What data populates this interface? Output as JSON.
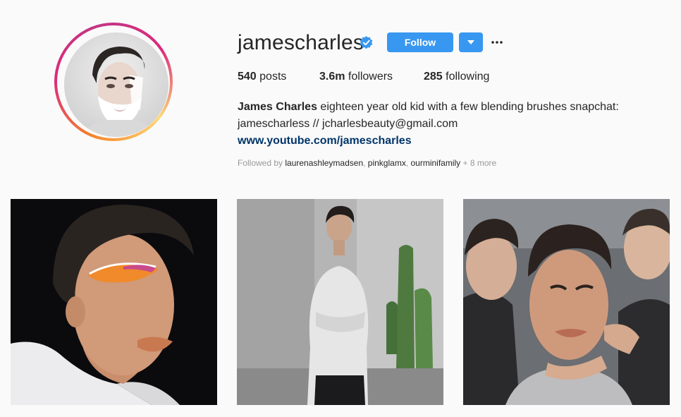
{
  "profile": {
    "username": "jamescharles",
    "verified_icon": "verified-badge-icon",
    "follow_label": "Follow",
    "more_label": "•••",
    "stats": {
      "posts_count": "540",
      "posts_label": "posts",
      "followers_count": "3.6m",
      "followers_label": "followers",
      "following_count": "285",
      "following_label": "following"
    },
    "bio": {
      "name": "James Charles",
      "text": " eighteen year old kid with a few blending brushes snapchat: jamescharless // jcharlesbeauty@gmail.com",
      "link": "www.youtube.com/jamescharles"
    },
    "followed_by": {
      "prefix": "Followed by ",
      "users": [
        "laurenashleymadsen",
        "pinkglamx",
        "ourminifamily"
      ],
      "suffix": " + 8 more"
    }
  },
  "colors": {
    "accent": "#3897f0",
    "link": "#003569",
    "muted": "#999999",
    "text": "#262626"
  }
}
